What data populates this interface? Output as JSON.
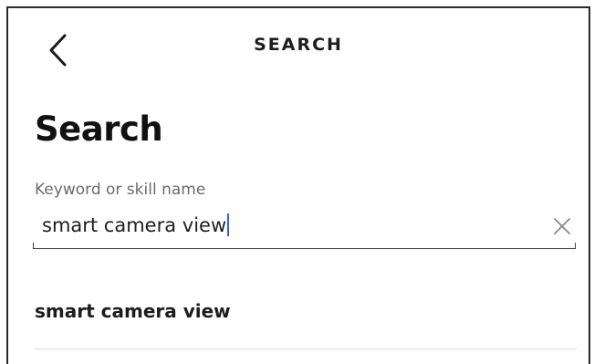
{
  "header": {
    "title": "SEARCH",
    "back_icon": "chevron-left-icon"
  },
  "page": {
    "title": "Search"
  },
  "search": {
    "label": "Keyword or skill name",
    "value": "smart camera view",
    "clear_icon": "close-icon",
    "caret_color": "#2962ff"
  },
  "suggestions": [
    {
      "label": "smart camera view"
    }
  ]
}
